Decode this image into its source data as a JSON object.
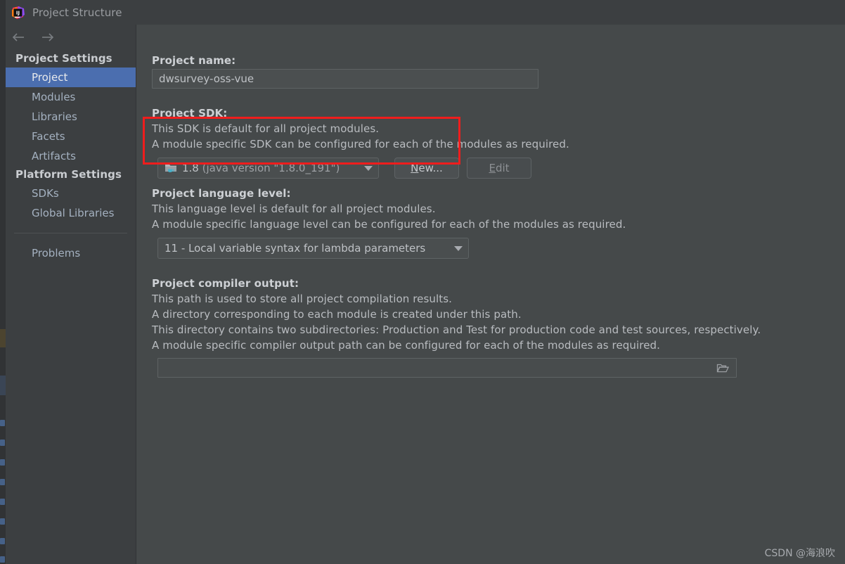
{
  "window": {
    "title": "Project Structure",
    "app_icon": "intellij-idea-icon"
  },
  "nav": {
    "back_icon": "arrow-left-icon",
    "forward_icon": "arrow-right-icon"
  },
  "sidebar": {
    "groups": [
      {
        "header": "Project Settings",
        "items": [
          {
            "label": "Project",
            "selected": true
          },
          {
            "label": "Modules",
            "selected": false
          },
          {
            "label": "Libraries",
            "selected": false
          },
          {
            "label": "Facets",
            "selected": false
          },
          {
            "label": "Artifacts",
            "selected": false
          }
        ]
      },
      {
        "header": "Platform Settings",
        "items": [
          {
            "label": "SDKs",
            "selected": false
          },
          {
            "label": "Global Libraries",
            "selected": false
          }
        ]
      }
    ],
    "extra_item": {
      "label": "Problems",
      "selected": false
    }
  },
  "main": {
    "project_name": {
      "label": "Project name:",
      "value": "dwsurvey-oss-vue",
      "placeholder": ""
    },
    "project_sdk": {
      "label": "Project SDK:",
      "description_lines": [
        "This SDK is default for all project modules.",
        "A module specific SDK can be configured for each of the modules as required."
      ],
      "selected_version": "1.8",
      "selected_detail": "(java version \"1.8.0_191\")",
      "icon": "java-sdk-folder-icon",
      "new_button": {
        "label": "New...",
        "mnemonic": "N"
      },
      "edit_button": {
        "label": "Edit",
        "mnemonic": "E",
        "disabled": true
      }
    },
    "language_level": {
      "label": "Project language level:",
      "description_lines": [
        "This language level is default for all project modules.",
        "A module specific language level can be configured for each of the modules as required."
      ],
      "selected": "11 - Local variable syntax for lambda parameters"
    },
    "compiler_output": {
      "label": "Project compiler output:",
      "description_lines": [
        "This path is used to store all project compilation results.",
        "A directory corresponding to each module is created under this path.",
        "This directory contains two subdirectories: Production and Test for production code and test sources, respectively.",
        "A module specific compiler output path can be configured for each of the modules as required."
      ],
      "value": "",
      "placeholder": "",
      "browse_icon": "open-folder-icon"
    }
  },
  "annotation": {
    "highlight_color": "#ef1d1d",
    "target": "project-sdk-row"
  },
  "watermark": {
    "text": "CSDN @海浪吹"
  },
  "colors": {
    "dialog_bg": "#45494a",
    "sidebar_bg": "#3c3f41",
    "titlebar_bg": "#3c3f41",
    "selection_blue": "#4b6eaf",
    "text_primary": "#cdd0d4",
    "text_secondary": "#b9bcc0",
    "link_blue": "#a4b1c0",
    "accent_red": "#ef1d1d"
  }
}
